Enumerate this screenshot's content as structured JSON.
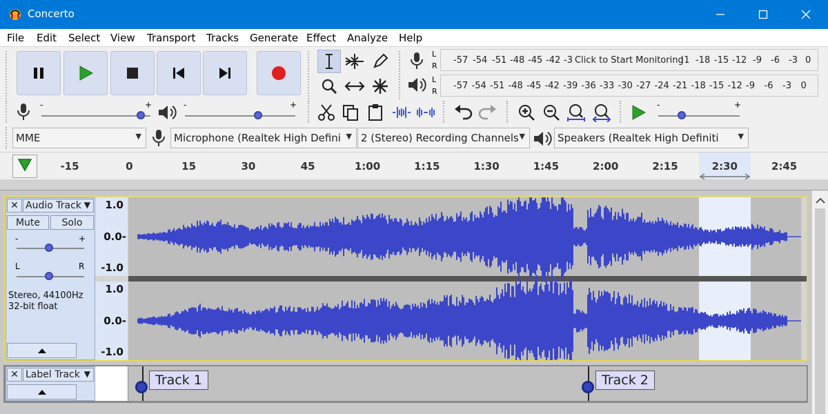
{
  "window": {
    "title": "Concerto"
  },
  "menu": [
    "File",
    "Edit",
    "Select",
    "View",
    "Transport",
    "Tracks",
    "Generate",
    "Effect",
    "Analyze",
    "Help"
  ],
  "meters": {
    "record": {
      "left": "L",
      "right": "R",
      "ticks": [
        "-57",
        "-54",
        "-51",
        "-48",
        "-45",
        "-42",
        "-3"
      ],
      "tail_ticks": [
        "!1",
        "-18",
        "-15",
        "-12",
        "-9",
        "-6",
        "-3",
        "0"
      ],
      "overlay": "Click to Start Monitoring"
    },
    "playback": {
      "left": "L",
      "right": "R",
      "ticks": [
        "-57",
        "-54",
        "-51",
        "-48",
        "-45",
        "-42",
        "-39",
        "-36",
        "-33",
        "-30",
        "-27",
        "-24",
        "-21",
        "-18",
        "-15",
        "-12",
        "-9",
        "-6",
        "-3",
        "0"
      ]
    }
  },
  "sliders": {
    "record_minus": "-",
    "record_plus": "+",
    "play_minus": "-",
    "play_plus": "+",
    "speed_minus": "-",
    "speed_plus": "+"
  },
  "device": {
    "host": "MME",
    "input": "Microphone (Realtek High Defini",
    "channels": "2 (Stereo) Recording Channels",
    "output": "Speakers (Realtek High Definiti"
  },
  "timeline": {
    "ticks": [
      "-15",
      "0",
      "15",
      "30",
      "45",
      "1:00",
      "1:15",
      "1:30",
      "1:45",
      "2:00",
      "2:15",
      "2:30",
      "2:45"
    ]
  },
  "audio_track": {
    "name": "Audio Track",
    "mute": "Mute",
    "solo": "Solo",
    "gain_minus": "-",
    "gain_plus": "+",
    "pan_left": "L",
    "pan_right": "R",
    "info_line1": "Stereo, 44100Hz",
    "info_line2": "32-bit float",
    "ruler_top": [
      "1.0",
      "0.0-",
      "-1.0"
    ],
    "ruler_bottom": [
      "1.0",
      "0.0-",
      "-1.0"
    ]
  },
  "label_track": {
    "name": "Label Track",
    "labels": [
      "Track 1",
      "Track 2"
    ]
  },
  "colors": {
    "titlebar": "#0078d7",
    "waveform": "#3c46c8",
    "selection": "#e8eefa",
    "record": "#e02020",
    "play": "#2ca02c"
  }
}
